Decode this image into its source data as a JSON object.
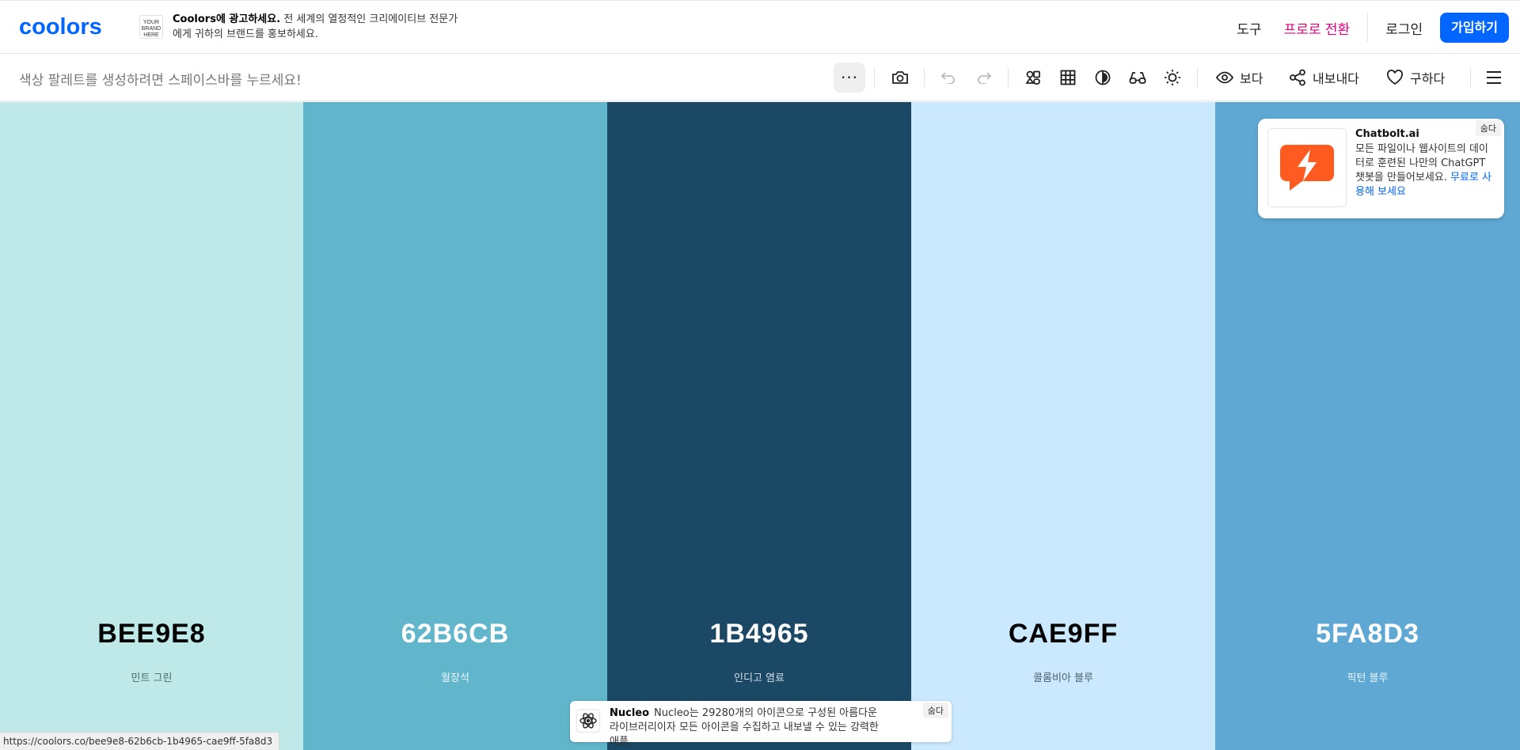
{
  "header": {
    "logo_text": "coolors",
    "ad_badge": "YOUR BRAND HERE",
    "ad_brand": "Coolors에 광고하세요.",
    "ad_text": "전 세계의 열정적인 크리에이티브 전문가에게 귀하의 브랜드를 홍보하세요.",
    "nav": {
      "tools": "도구",
      "pro": "프로로 전환",
      "login": "로그인",
      "signup": "가입하기"
    },
    "colors": {
      "accent": "#0066ff",
      "pro": "#e3007e"
    }
  },
  "toolbar": {
    "hint": "색상 팔레트를 생성하려면 스페이스바를 누르세요!",
    "more": "···",
    "view_label": "보다",
    "export_label": "내보내다",
    "save_label": "구하다",
    "icons": [
      "more-icon",
      "camera-icon",
      "undo-icon",
      "redo-icon",
      "adjust-palette-icon",
      "grid-icon",
      "contrast-icon",
      "glasses-icon",
      "brightness-icon",
      "eye-icon",
      "share-icon",
      "heart-icon",
      "menu-icon"
    ]
  },
  "palette": {
    "swatches": [
      {
        "hex": "BEE9E8",
        "name": "민트 그린",
        "color": "#BEE9E8",
        "text_color": "#000000",
        "name_color": "#4a6b6a"
      },
      {
        "hex": "62B6CB",
        "name": "월장석",
        "color": "#62B6CB",
        "text_color": "#ffffff",
        "name_color": "#e8f6fa"
      },
      {
        "hex": "1B4965",
        "name": "인디고 염료",
        "color": "#1B4965",
        "text_color": "#ffffff",
        "name_color": "#d2dde5"
      },
      {
        "hex": "CAE9FF",
        "name": "콜롬비아 블루",
        "color": "#CAE9FF",
        "text_color": "#000000",
        "name_color": "#50606b"
      },
      {
        "hex": "5FA8D3",
        "name": "픽턴 블루",
        "color": "#5FA8D3",
        "text_color": "#ffffff",
        "name_color": "#e8f3fa"
      }
    ]
  },
  "ads": {
    "side": {
      "title": "Chatbolt.ai",
      "body": "모든 파일이나 웹사이트의 데이터로 훈련된 나만의 ChatGPT 챗봇을 만들어보세요.",
      "cta": "무료로 사용해 보세요",
      "hide": "숨다"
    },
    "bottom": {
      "title": "Nucleo",
      "body": "Nucleo는 29280개의 아이콘으로 구성된 아름다운 라이브러리이자 모든 아이콘을 수집하고 내보낼 수 있는 강력한 애플",
      "hide": "숨다"
    }
  },
  "status_url": "https://coolors.co/bee9e8-62b6cb-1b4965-cae9ff-5fa8d3"
}
